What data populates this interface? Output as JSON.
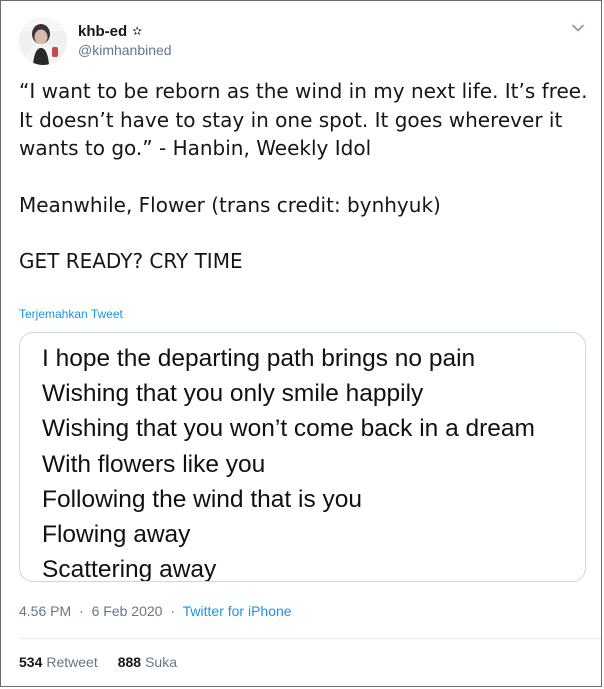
{
  "author": {
    "display_name": "khb-ed",
    "badge_icon": "star-icon",
    "badge_glyph": "✫",
    "handle": "@kimhanbined"
  },
  "menu": {
    "icon": "chevron-down-icon"
  },
  "tweet": {
    "paragraphs": [
      "“I want to be reborn as the wind in my next life. It’s free. It doesn’t have to stay in one spot. It goes wherever it wants to go.” - Hanbin, Weekly Idol",
      "Meanwhile, Flower (trans credit: bynhyuk)",
      "GET READY? CRY TIME"
    ],
    "translate_label": "Terjemahkan Tweet"
  },
  "media": {
    "lyrics": [
      "I hope the departing path brings no pain",
      "Wishing that you only smile happily",
      "Wishing that you won’t come back in a dream",
      "With flowers like you",
      "Following the wind that is you",
      "Flowing away",
      "Scattering away"
    ]
  },
  "meta": {
    "time": "4.56 PM",
    "date": "6 Feb 2020",
    "separator": "·",
    "source": "Twitter for iPhone"
  },
  "stats": {
    "retweets": "534",
    "retweets_label": "Retweet",
    "likes": "888",
    "likes_label": "Suka"
  },
  "colors": {
    "link": "#1b95e0",
    "muted": "#657786",
    "text": "#14171a",
    "border": "#ccd6dd"
  }
}
